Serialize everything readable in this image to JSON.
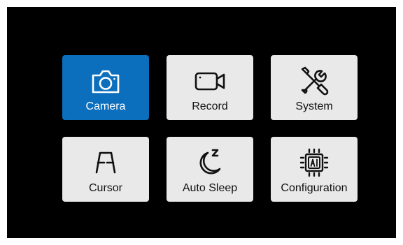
{
  "menu": {
    "selected": "camera",
    "tiles": [
      {
        "id": "camera",
        "label": "Camera",
        "icon": "camera-icon"
      },
      {
        "id": "record",
        "label": "Record",
        "icon": "video-camera-icon"
      },
      {
        "id": "system",
        "label": "System",
        "icon": "tools-icon"
      },
      {
        "id": "cursor",
        "label": "Cursor",
        "icon": "cursor-lines-icon"
      },
      {
        "id": "auto_sleep",
        "label": "Auto Sleep",
        "icon": "moon-sleep-icon"
      },
      {
        "id": "configuration",
        "label": "Configuration",
        "icon": "ai-chip-icon"
      }
    ]
  },
  "colors": {
    "background": "#000000",
    "tile": "#e9e9e9",
    "selected_tile": "#0b6fbe",
    "text_dark": "#111111",
    "text_light": "#ffffff"
  }
}
